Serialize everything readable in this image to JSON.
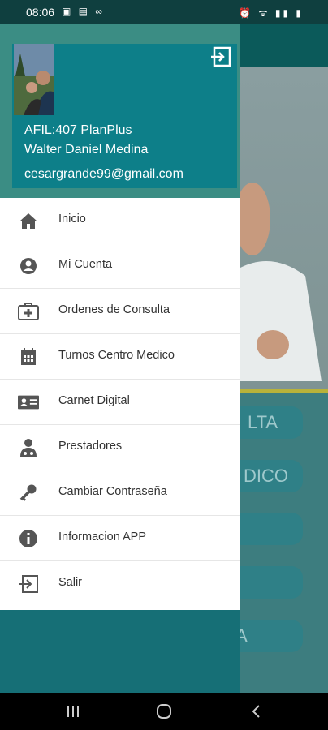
{
  "status_bar": {
    "time": "08:06",
    "left_icons": "▣ ▤ ∞",
    "right_icons": "⏰ ᯤ ▮▮ ▮"
  },
  "header": {
    "afil": "AFIL:407 PlanPlus",
    "name": "Walter Daniel Medina",
    "email": "cesargrande99@gmail.com"
  },
  "menu": {
    "items": [
      {
        "label": "Inicio",
        "icon": "home-icon"
      },
      {
        "label": "Mi Cuenta",
        "icon": "account-icon"
      },
      {
        "label": "Ordenes de Consulta",
        "icon": "medical-bag-icon"
      },
      {
        "label": "Turnos Centro Medico",
        "icon": "calendar-icon"
      },
      {
        "label": "Carnet Digital",
        "icon": "id-card-icon"
      },
      {
        "label": "Prestadores",
        "icon": "doctor-icon"
      },
      {
        "label": "Cambiar Contraseña",
        "icon": "key-icon"
      },
      {
        "label": "Informacion APP",
        "icon": "info-icon"
      },
      {
        "label": "Salir",
        "icon": "exit-icon"
      }
    ]
  },
  "background_buttons": [
    "LTA",
    "DICO",
    "",
    "",
    "A"
  ],
  "colors": {
    "teal": "#0d7f89",
    "drawer": "#166f76",
    "appbar": "#0b5a5a",
    "accent": "#b8b23a"
  }
}
